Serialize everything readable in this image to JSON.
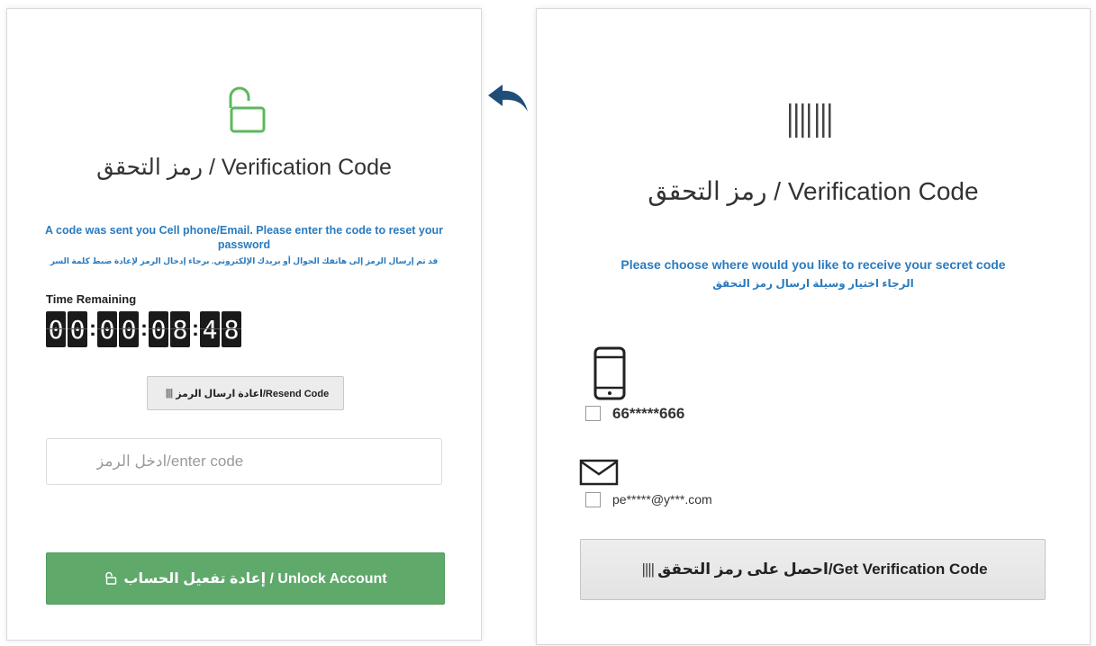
{
  "left": {
    "title": "رمز التحقق / Verification Code",
    "message_en": "A code was sent you Cell phone/Email. Please enter the code to reset your password",
    "message_ar": "قد تم إرسال الرمز إلى هاتفك الجوال أو بريدك الإلكتروني. برجاء إدخال الرمز لإعادة ضبط كلمة السر",
    "time_label": "Time Remaining",
    "timer_digits": [
      "0",
      "0",
      "0",
      "0",
      "0",
      "8",
      "4",
      "8"
    ],
    "resend_label": "اعادة ارسال الرمز/Resend Code",
    "code_placeholder": "ادخل الرمز/enter code",
    "unlock_label": "إعادة تفعيل الحساب / Unlock Account"
  },
  "right": {
    "title": "رمز التحقق / Verification Code",
    "message_en": "Please choose where would you like to receive your secret code",
    "message_ar": "الرجاء اختيار وسيلة ارسال رمز التحقق",
    "phone_option": "66*****666",
    "email_option": "pe*****@y***.com",
    "get_code_label": "احصل على رمز التحقق/Get Verification Code"
  },
  "icons": {
    "lock": "unlock-icon",
    "arrow": "back-arrow-icon",
    "barcode": "barcode-icon",
    "phone": "phone-icon",
    "mail": "mail-icon"
  },
  "colors": {
    "accent_blue": "#2a7bbf",
    "unlock_green": "#5fa96b",
    "arrow_blue": "#1f4e78",
    "lock_green": "#5cb85c"
  }
}
